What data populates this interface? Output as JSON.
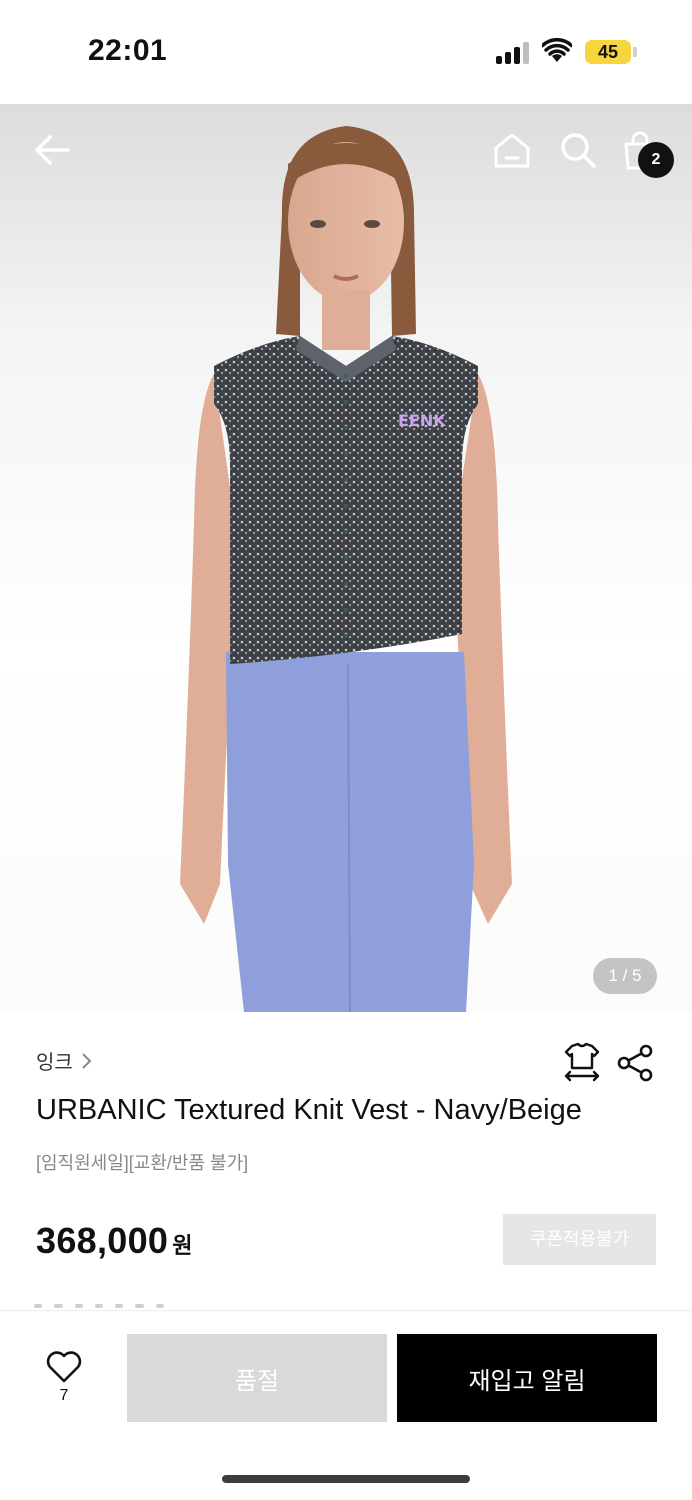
{
  "status_bar": {
    "time": "22:01",
    "battery": "45",
    "icons": [
      "signal-icon",
      "wifi-icon",
      "battery-icon"
    ]
  },
  "header": {
    "icons": [
      "back-arrow-icon",
      "home-icon",
      "search-icon",
      "shopping-bag-icon"
    ],
    "cart_count": "2"
  },
  "gallery": {
    "current": 1,
    "total": 5,
    "indicator": "1 / 5",
    "logo_text": "EENK"
  },
  "product": {
    "brand": "잉크",
    "title": "URBANIC Textured Knit Vest - Navy/Beige",
    "tags": "[임직원세일][교환/반품 불가]",
    "price": "368,000",
    "currency": "원",
    "coupon_label": "쿠폰적용불가",
    "icons": [
      "size-guide-icon",
      "share-icon"
    ]
  },
  "bottom_bar": {
    "like_count": "7",
    "soldout_label": "품절",
    "restock_label": "재입고 알림",
    "icons": [
      "heart-icon"
    ]
  },
  "colors": {
    "accent": "#000000",
    "disabled": "#d9d9d9",
    "battery": "#f7d53c",
    "pants": "#8f9fdc",
    "vest": "#3b4048"
  }
}
